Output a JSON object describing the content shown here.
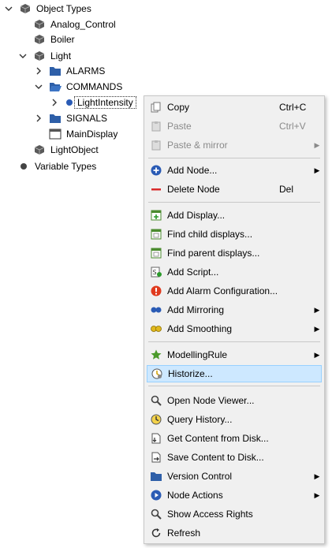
{
  "tree": {
    "object_types": "Object Types",
    "analog_control": "Analog_Control",
    "boiler": "Boiler",
    "light": "Light",
    "alarms": "ALARMS",
    "commands": "COMMANDS",
    "light_intensity": "LightIntensity",
    "signals": "SIGNALS",
    "main_display": "MainDisplay",
    "light_object": "LightObject",
    "variable_types": "Variable Types"
  },
  "menu": {
    "copy": "Copy",
    "copy_shortcut": "Ctrl+C",
    "paste": "Paste",
    "paste_shortcut": "Ctrl+V",
    "paste_mirror": "Paste & mirror",
    "add_node": "Add Node...",
    "delete_node": "Delete Node",
    "delete_shortcut": "Del",
    "add_display": "Add Display...",
    "find_child": "Find child displays...",
    "find_parent": "Find parent displays...",
    "add_script": "Add Script...",
    "add_alarm": "Add Alarm Configuration...",
    "add_mirroring": "Add Mirroring",
    "add_smoothing": "Add Smoothing",
    "modelling_rule": "ModellingRule",
    "historize": "Historize...",
    "open_node_viewer": "Open Node Viewer...",
    "query_history": "Query History...",
    "get_content": "Get Content from Disk...",
    "save_content": "Save Content to Disk...",
    "version_control": "Version Control",
    "node_actions": "Node Actions",
    "show_access": "Show Access Rights",
    "refresh": "Refresh"
  }
}
